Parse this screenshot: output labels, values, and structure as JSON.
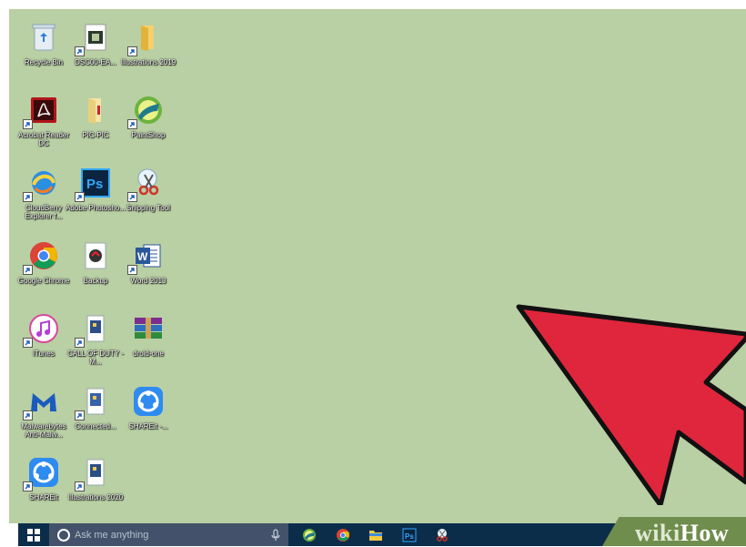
{
  "desktop": {
    "icons": [
      {
        "label": "Recycle Bin"
      },
      {
        "label": "DSC00-EA..."
      },
      {
        "label": "Illustrations 2019"
      },
      {
        "label": "Acrobat Reader DC"
      },
      {
        "label": "PIC-PIC"
      },
      {
        "label": "PaintShop"
      },
      {
        "label": "CloudBerry Explorer f..."
      },
      {
        "label": "Adobe Photosho..."
      },
      {
        "label": "Snipping Tool"
      },
      {
        "label": "Google Chrome"
      },
      {
        "label": "Backup"
      },
      {
        "label": "Word 2013"
      },
      {
        "label": "iTunes"
      },
      {
        "label": "CALL OF DUTY - M..."
      },
      {
        "label": "droid-one"
      },
      {
        "label": "Malwarebytes Anti-Malw..."
      },
      {
        "label": "Connected..."
      },
      {
        "label": "SHAREit -..."
      },
      {
        "label": "SHAREit"
      },
      {
        "label": "Illustrations 2020"
      }
    ]
  },
  "taskbar": {
    "search_placeholder": "Ask me anything",
    "pinned": [
      {
        "name": "paintshop"
      },
      {
        "name": "chrome"
      },
      {
        "name": "file-explorer"
      },
      {
        "name": "photoshop"
      },
      {
        "name": "snipping-tool"
      }
    ]
  },
  "watermark": {
    "wiki": "wiki",
    "how": "How"
  },
  "colors": {
    "desktop_bg": "#b9cfa4",
    "taskbar_bg": "#0c2d4a",
    "search_bg": "#43526a",
    "arrow_fill": "#e0263c",
    "watermark_bg": "#6f8d4c"
  }
}
